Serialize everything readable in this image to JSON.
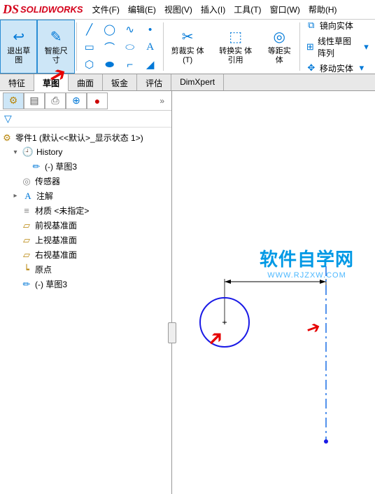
{
  "logo": {
    "ds": "DS",
    "text": "SOLIDWORKS"
  },
  "menu": {
    "file": "文件(F)",
    "edit": "编辑(E)",
    "view": "视图(V)",
    "insert": "插入(I)",
    "tools": "工具(T)",
    "window": "窗口(W)",
    "help": "帮助(H)"
  },
  "ribbon": {
    "exit_sketch": "退出草\n图",
    "smart_dim": "智能尺\n寸",
    "trim": "剪裁实\n体(T)",
    "convert": "转换实\n体引用",
    "offset": "等距实\n体",
    "mirror": "镜向实体",
    "linear_pattern": "线性草图阵列",
    "move": "移动实体"
  },
  "tabs": {
    "feature": "特征",
    "sketch": "草图",
    "surface": "曲面",
    "sheetmetal": "钣金",
    "evaluate": "评估",
    "dimxpert": "DimXpert"
  },
  "tree": {
    "root": "零件1 (默认<<默认>_显示状态 1>)",
    "history": "History",
    "sketch3a": "(-) 草图3",
    "sensors": "传感器",
    "annotations": "注解",
    "material": "材质 <未指定>",
    "front": "前视基准面",
    "top": "上视基准面",
    "right": "右视基准面",
    "origin": "原点",
    "sketch3b": "(-) 草图3"
  },
  "watermark": {
    "line1": "软件自学网",
    "line2": "WWW.RJZXW.COM"
  }
}
